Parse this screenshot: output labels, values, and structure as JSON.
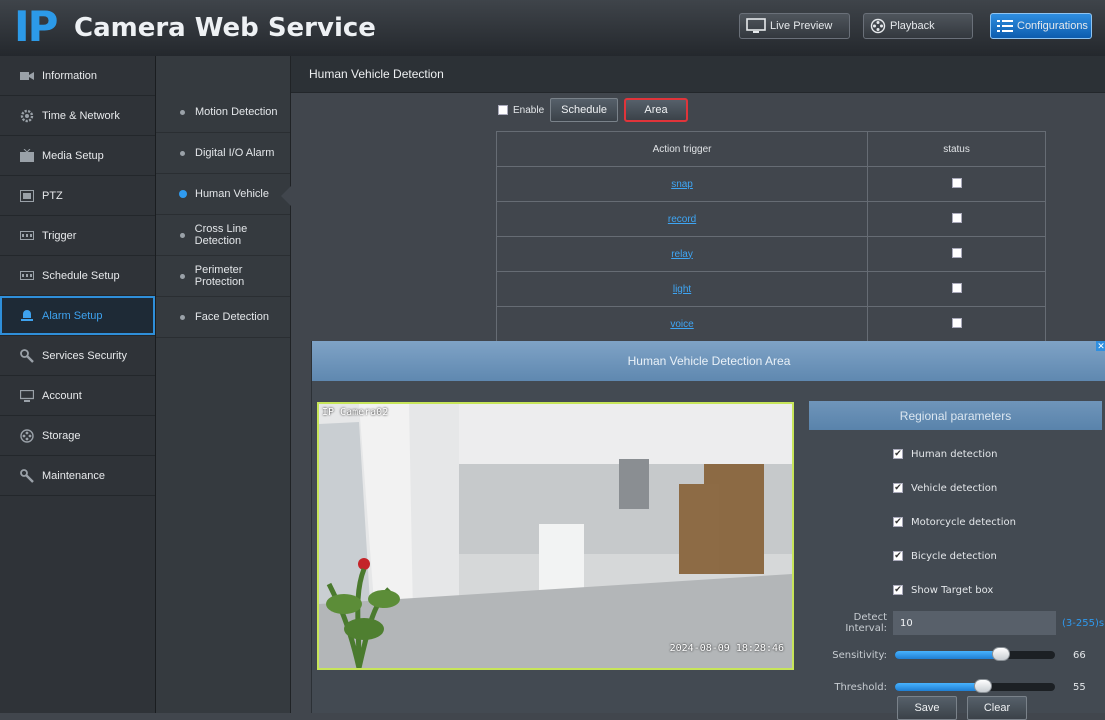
{
  "header": {
    "logo_ip": "IP",
    "logo_text": "Camera Web Service",
    "buttons": [
      {
        "label": "Live Preview",
        "icon": "monitor-icon"
      },
      {
        "label": "Playback",
        "icon": "film-reel-icon"
      },
      {
        "label": "Configurations",
        "icon": "list-icon",
        "active": true
      }
    ]
  },
  "sidebar": {
    "items": [
      {
        "label": "Information",
        "icon": "info-icon"
      },
      {
        "label": "Time & Network",
        "icon": "gear-icon"
      },
      {
        "label": "Media Setup",
        "icon": "tv-icon"
      },
      {
        "label": "PTZ",
        "icon": "ptz-icon"
      },
      {
        "label": "Trigger",
        "icon": "trigger-icon"
      },
      {
        "label": "Schedule Setup",
        "icon": "schedule-icon"
      },
      {
        "label": "Alarm Setup",
        "icon": "alarm-icon",
        "active": true
      },
      {
        "label": "Services Security",
        "icon": "shield-icon"
      },
      {
        "label": "Account",
        "icon": "monitor-icon"
      },
      {
        "label": "Storage",
        "icon": "storage-icon"
      },
      {
        "label": "Maintenance",
        "icon": "wrench-icon"
      }
    ]
  },
  "subnav": {
    "items": [
      {
        "label": "Motion Detection"
      },
      {
        "label": "Digital I/O Alarm"
      },
      {
        "label": "Human Vehicle",
        "active": true
      },
      {
        "label": "Cross Line Detection"
      },
      {
        "label": "Perimeter Protection"
      },
      {
        "label": "Face Detection"
      }
    ]
  },
  "main": {
    "title": "Human Vehicle Detection",
    "enable_label": "Enable",
    "schedule_button": "Schedule",
    "area_button": "Area",
    "table": {
      "headers": [
        "Action trigger",
        "status"
      ],
      "rows": [
        {
          "action": "snap",
          "status": false
        },
        {
          "action": "record",
          "status": false
        },
        {
          "action": "relay",
          "status": false
        },
        {
          "action": "light",
          "status": false
        },
        {
          "action": "voice",
          "status": false
        }
      ]
    }
  },
  "dialog": {
    "title": "Human Vehicle Detection Area",
    "video": {
      "osd_name": "IP Camera02",
      "osd_time": "2024-08-09 18:28:46"
    },
    "params": {
      "title": "Regional parameters",
      "checks": [
        {
          "label": "Human detection",
          "checked": true
        },
        {
          "label": "Vehicle detection",
          "checked": true
        },
        {
          "label": "Motorcycle detection",
          "checked": true
        },
        {
          "label": "Bicycle detection",
          "checked": true
        },
        {
          "label": "Show Target box",
          "checked": true
        }
      ],
      "detect_interval_label": "Detect Interval:",
      "detect_interval_value": "10",
      "detect_interval_range": "(3-255)s",
      "sensitivity_label": "Sensitivity:",
      "sensitivity_value": 66,
      "threshold_label": "Threshold:",
      "threshold_value": 55,
      "save_button": "Save",
      "clear_button": "Clear"
    }
  },
  "colors": {
    "accent": "#2f9bf0",
    "area_highlight": "#e0343a",
    "video_border": "#c7e55a"
  }
}
